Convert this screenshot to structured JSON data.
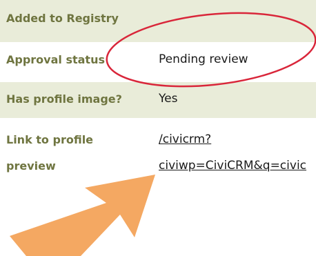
{
  "rows": [
    {
      "label": "Added to Registry",
      "value": ""
    },
    {
      "label": "Approval status",
      "value": "Pending review"
    },
    {
      "label": "Has profile image?",
      "value": "Yes"
    },
    {
      "label_line1": "Link to profile",
      "label_line2": "preview",
      "link_line1": "/civicrm?",
      "link_line2": "civiwp=CiviCRM&q=civic"
    }
  ],
  "colors": {
    "row_stripe": "#e9ecd9",
    "label_text": "#6f7540",
    "annotation_ellipse": "#d9263a",
    "annotation_arrow": "#f4a862"
  },
  "annotations": {
    "ellipse_icon": "red-ellipse-highlight",
    "arrow_icon": "orange-arrow-pointer"
  }
}
